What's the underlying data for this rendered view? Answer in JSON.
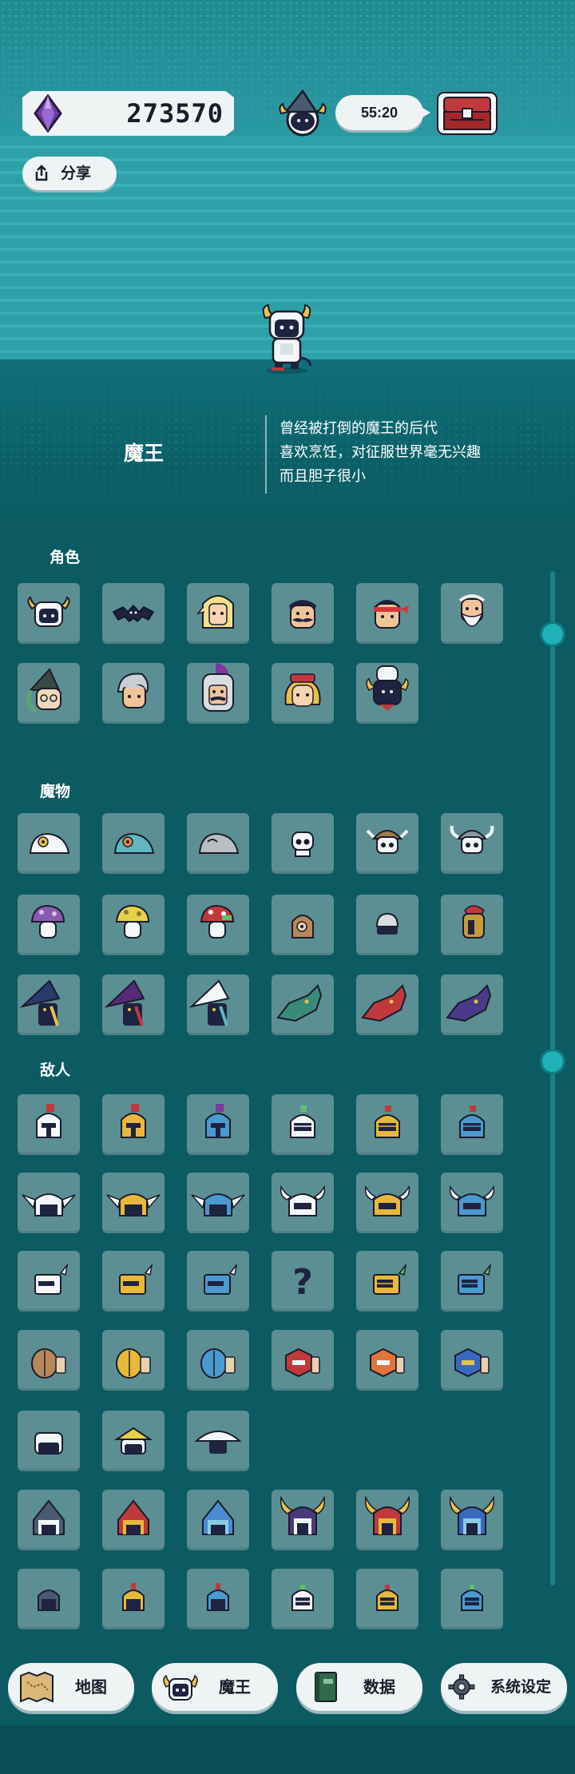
{
  "hud": {
    "gem_count": "273570",
    "timer": "55:20",
    "share_label": "分享"
  },
  "character": {
    "name": "魔王",
    "description": [
      "曾经被打倒的魔王的后代",
      "喜欢烹饪，对征服世界毫无兴趣",
      "而且胆子很小"
    ]
  },
  "sections": {
    "characters": "角色",
    "monsters": "魔物",
    "enemies": "敌人"
  },
  "nav": {
    "map": "地图",
    "demon_king": "魔王",
    "data": "数据",
    "settings": "系统设定"
  },
  "colors": {
    "background": "#0c5a62",
    "tile": "#5b8f93",
    "accent": "#1fb0b8",
    "button": "#eef3f4"
  }
}
